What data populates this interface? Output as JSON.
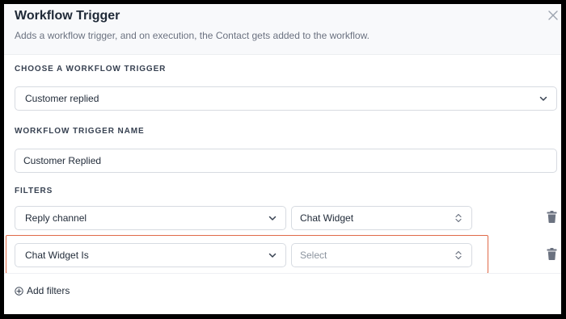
{
  "dialog": {
    "title": "Workflow Trigger",
    "subtitle": "Adds a workflow trigger, and on execution, the Contact gets added to the workflow."
  },
  "trigger": {
    "label": "CHOOSE A WORKFLOW TRIGGER",
    "value": "Customer replied"
  },
  "trigger_name": {
    "label": "WORKFLOW TRIGGER NAME",
    "value": "Customer Replied"
  },
  "filters": {
    "label": "FILTERS",
    "rows": [
      {
        "field": "Reply channel",
        "value": "Chat Widget",
        "value_is_placeholder": false
      },
      {
        "field": "Chat Widget Is",
        "value": "Select",
        "value_is_placeholder": true
      }
    ],
    "add_label": "Add filters"
  },
  "colors": {
    "highlight": "#e06a48",
    "text": "#1f2937",
    "muted": "#6b7280",
    "border": "#d7dbe1"
  },
  "icons": [
    "close-icon",
    "chevron-down-icon",
    "up-down-chevron-icon",
    "trash-icon",
    "plus-circle-icon"
  ]
}
